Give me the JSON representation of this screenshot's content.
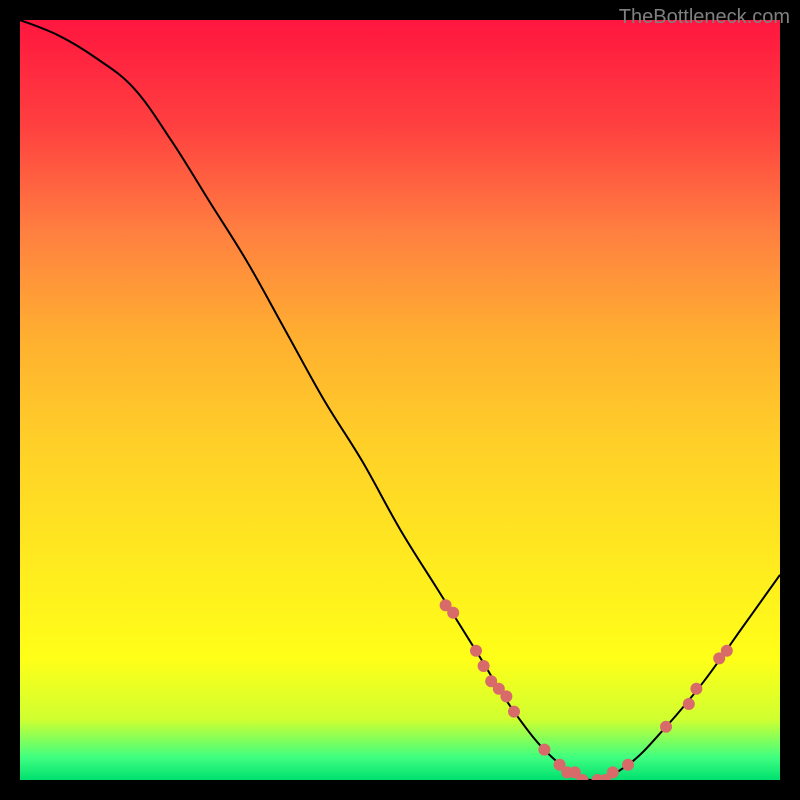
{
  "attribution": "TheBottleneck.com",
  "chart_data": {
    "type": "line",
    "title": "",
    "xlabel": "",
    "ylabel": "",
    "xlim": [
      0,
      100
    ],
    "ylim": [
      0,
      100
    ],
    "x": [
      0,
      5,
      10,
      15,
      20,
      25,
      30,
      35,
      40,
      45,
      50,
      55,
      60,
      65,
      70,
      75,
      80,
      85,
      90,
      95,
      100
    ],
    "values": [
      100,
      98,
      95,
      91,
      84,
      76,
      68,
      59,
      50,
      42,
      33,
      25,
      17,
      9,
      3,
      0,
      2,
      7,
      13,
      20,
      27
    ],
    "markers": [
      {
        "x": 56,
        "y": 23
      },
      {
        "x": 57,
        "y": 22
      },
      {
        "x": 60,
        "y": 17
      },
      {
        "x": 61,
        "y": 15
      },
      {
        "x": 62,
        "y": 13
      },
      {
        "x": 63,
        "y": 12
      },
      {
        "x": 64,
        "y": 11
      },
      {
        "x": 65,
        "y": 9
      },
      {
        "x": 69,
        "y": 4
      },
      {
        "x": 71,
        "y": 2
      },
      {
        "x": 72,
        "y": 1
      },
      {
        "x": 73,
        "y": 1
      },
      {
        "x": 74,
        "y": 0
      },
      {
        "x": 76,
        "y": 0
      },
      {
        "x": 77,
        "y": 0
      },
      {
        "x": 78,
        "y": 1
      },
      {
        "x": 80,
        "y": 2
      },
      {
        "x": 85,
        "y": 7
      },
      {
        "x": 88,
        "y": 10
      },
      {
        "x": 89,
        "y": 12
      },
      {
        "x": 92,
        "y": 16
      },
      {
        "x": 93,
        "y": 17
      }
    ]
  }
}
